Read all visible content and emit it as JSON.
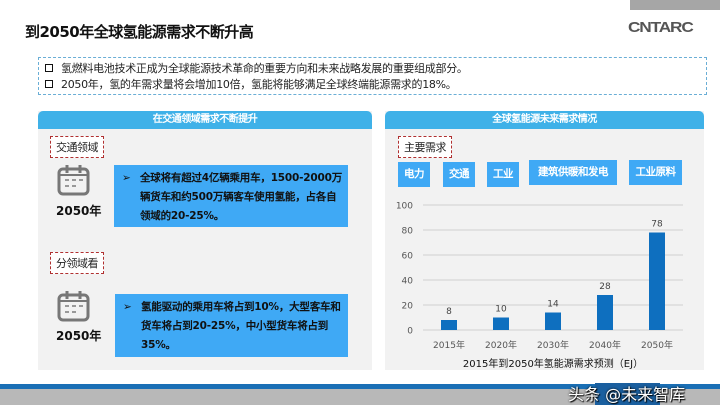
{
  "title": "到2050年全球氢能源需求不断升高",
  "logo": "CNTARC",
  "intro": [
    "氢燃料电池技术正成为全球能源技术革命的重要方向和未来战略发展的重要组成部分。",
    "2050年，氢的年需求量将会增加10倍，氢能将能够满足全球终端能源需求的18%。"
  ],
  "left": {
    "header": "在交通领域需求不断提升",
    "sections": [
      {
        "tag": "交通领域",
        "year": "2050年",
        "arrow": "➢",
        "text": "全球将有超过4亿辆乘用车，1500-2000万辆货车和约500万辆客车使用氢能，占各自领域的20-25%。"
      },
      {
        "tag": "分领域看",
        "year": "2050年",
        "arrow": "➢",
        "text": "氢能驱动的乘用车将占到10%，大型客车和货车将占到20-25%，中小型货车将占到35%。"
      }
    ]
  },
  "right": {
    "header": "全球氢能源未来需求情况",
    "tag": "主要需求",
    "categories": [
      "电力",
      "交通",
      "工业",
      "建筑供暖和发电",
      "工业原料"
    ]
  },
  "chart_data": {
    "type": "bar",
    "title": "2015年到2050年氢能源需求预测（EJ）",
    "categories": [
      "2015年",
      "2020年",
      "2030年",
      "2040年",
      "2050年"
    ],
    "values": [
      8,
      10,
      14,
      28,
      78
    ],
    "ylim": [
      0,
      100
    ],
    "yticks": [
      0,
      20,
      40,
      60,
      80,
      100
    ],
    "grid": true,
    "color": "#0e6fbf"
  },
  "watermark": "头条 @未来智库"
}
